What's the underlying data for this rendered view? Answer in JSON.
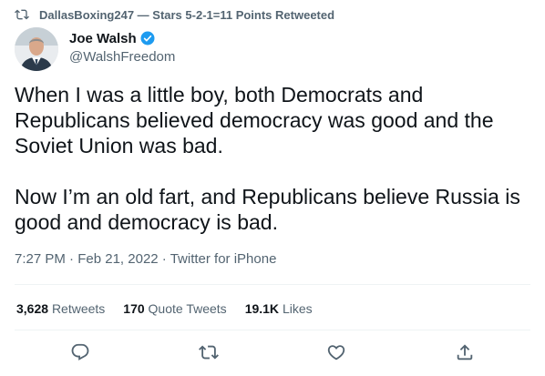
{
  "retweet": {
    "text": "DallasBoxing247 — Stars 5-2-1=11 Points Retweeted",
    "icon": "retweet-icon"
  },
  "author": {
    "name": "Joe Walsh",
    "handle": "@WalshFreedom",
    "verified_icon": "verified-badge-icon"
  },
  "tweet": {
    "text": "When I was a little boy, both Democrats and Republicans believed democracy was good and the Soviet Union was bad.\n\nNow I’m an old fart, and Republicans believe Russia is good and democracy is bad."
  },
  "meta": {
    "time": "7:27 PM",
    "date": "Feb 21, 2022",
    "source": "Twitter for iPhone",
    "separator": " · "
  },
  "stats": {
    "retweets": {
      "count": "3,628",
      "label": "Retweets"
    },
    "quotes": {
      "count": "170",
      "label": "Quote Tweets"
    },
    "likes": {
      "count": "19.1K",
      "label": "Likes"
    }
  },
  "actions": [
    "reply-icon",
    "retweet-icon",
    "like-icon",
    "share-icon"
  ],
  "colors": {
    "text": "#0f1419",
    "secondary": "#536471",
    "verified": "#1d9bf0",
    "divider": "#eff3f4"
  }
}
